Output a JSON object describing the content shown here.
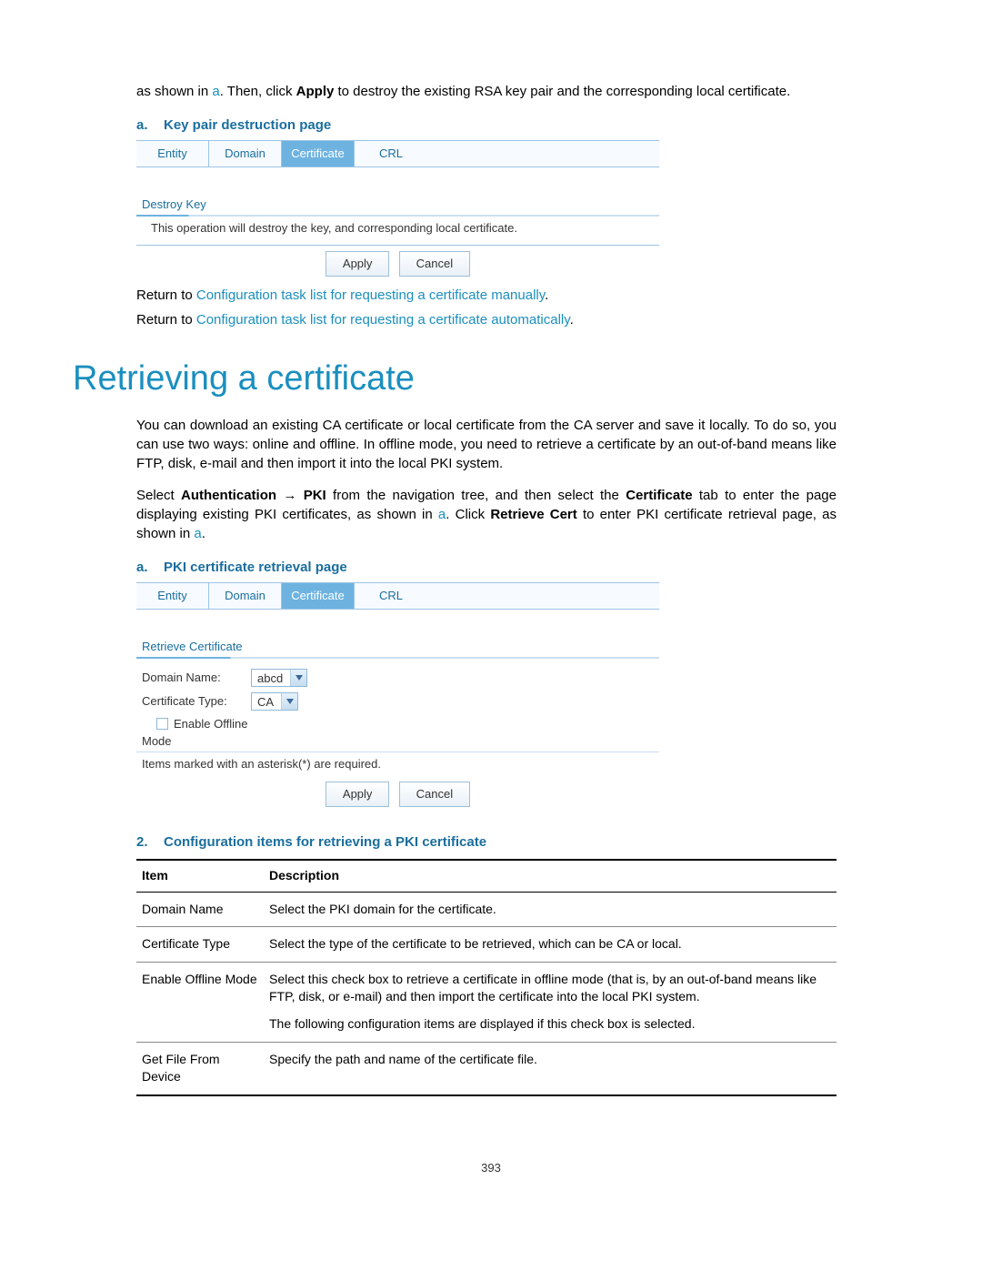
{
  "intro": {
    "pre": "as shown in ",
    "link": "a",
    "post1": ". Then, click ",
    "bold": "Apply",
    "post2": " to destroy the existing RSA key pair and the corresponding local certificate."
  },
  "caption1": {
    "letter": "a.",
    "text": "Key pair destruction page"
  },
  "tabs": {
    "entity": "Entity",
    "domain": "Domain",
    "certificate": "Certificate",
    "crl": "CRL"
  },
  "destroy": {
    "label": "Destroy Key",
    "text": "This operation will destroy the key, and corresponding local certificate."
  },
  "buttons": {
    "apply": "Apply",
    "cancel": "Cancel"
  },
  "return1": {
    "pre": "Return to ",
    "link": "Configuration task list for requesting a certificate manually",
    "post": "."
  },
  "return2": {
    "pre": "Return to ",
    "link": "Configuration task list for requesting a certificate automatically",
    "post": "."
  },
  "section": "Retrieving a certificate",
  "para1": "You can download an existing CA certificate or local certificate from the CA server and save it locally. To do so, you can use two ways: online and offline. In offline mode, you need to retrieve a certificate by an out-of-band means like FTP, disk, e-mail and then import it into the local PKI system.",
  "para2": {
    "t1": "Select ",
    "b1": "Authentication",
    "arrow": " → ",
    "b2": "PKI",
    "t2": " from the navigation tree, and then select the ",
    "b3": "Certificate",
    "t3": " tab to enter the page displaying existing PKI certificates, as shown in ",
    "l1": "a",
    "t4": ". Click ",
    "b4": "Retrieve Cert",
    "t5": " to enter PKI certificate retrieval page, as shown in ",
    "l2": "a",
    "t6": "."
  },
  "caption2": {
    "letter": "a.",
    "text": "PKI certificate retrieval page"
  },
  "retrieve": {
    "header": "Retrieve Certificate",
    "domain_label": "Domain Name:",
    "domain_value": "abcd",
    "type_label": "Certificate Type:",
    "type_value": "CA",
    "offline": "Enable Offline",
    "mode": "Mode",
    "note": "Items marked with an asterisk(*) are required."
  },
  "caption3": {
    "letter": "2.",
    "text": "Configuration items for retrieving a PKI certificate"
  },
  "table": {
    "h1": "Item",
    "h2": "Description",
    "rows": [
      {
        "item": "Domain Name",
        "desc1": "Select the PKI domain for the certificate."
      },
      {
        "item": "Certificate Type",
        "desc1": "Select the type of the certificate to be retrieved, which can be CA or local."
      },
      {
        "item": "Enable Offline Mode",
        "desc1": "Select this check box to retrieve a certificate in offline mode (that is, by an out-of-band means like FTP, disk, or e-mail) and then import the certificate into the local PKI system.",
        "desc2": "The following configuration items are displayed if this check box is selected."
      },
      {
        "item": "Get File From Device",
        "desc1": "Specify the path and name of the certificate file."
      }
    ]
  },
  "pagenum": "393"
}
